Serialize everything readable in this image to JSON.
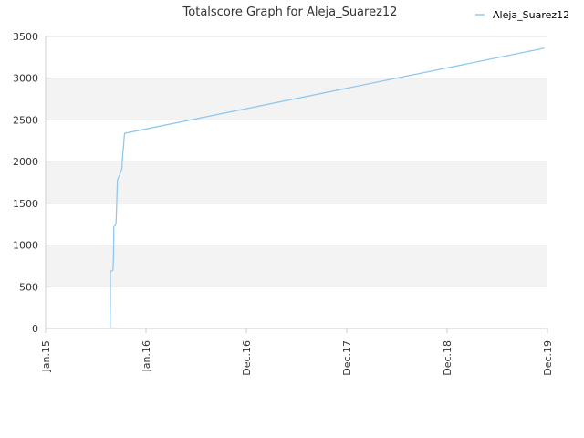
{
  "chart_data": {
    "type": "line",
    "title": "Totalscore Graph for Aleja_Suarez12",
    "xlabel": "",
    "ylabel": "",
    "x_ticks": [
      "Jan.15",
      "Jan.16",
      "Dec.16",
      "Dec.17",
      "Dec.18",
      "Dec.19"
    ],
    "y_ticks": [
      0,
      500,
      1000,
      1500,
      2000,
      2500,
      3000,
      3500
    ],
    "xlim": [
      "2015-01-01",
      "2019-12-01"
    ],
    "ylim": [
      0,
      3500
    ],
    "grid": "horizontal bands",
    "legend_position": "top-right",
    "colors": {
      "series": "#90c8ef",
      "band": "#f3f3f3",
      "grid": "#dddddd",
      "axis": "#cccccc"
    },
    "series": [
      {
        "name": "Aleja_Suarez12",
        "x": [
          "2015-08-20",
          "2015-08-21",
          "2015-08-30",
          "2015-09-01",
          "2015-09-02",
          "2015-09-08",
          "2015-09-10",
          "2015-09-15",
          "2015-09-25",
          "2015-10-01",
          "2015-10-02",
          "2015-10-03",
          "2015-10-04",
          "2015-10-05",
          "2015-10-06",
          "2015-10-07",
          "2015-10-08",
          "2015-10-09",
          "2015-10-10",
          "2015-10-11",
          "2019-11-20"
        ],
        "values": [
          0,
          680,
          700,
          860,
          1220,
          1240,
          1270,
          1780,
          1860,
          1920,
          2000,
          2050,
          2100,
          2130,
          2150,
          2200,
          2250,
          2290,
          2320,
          2340,
          3360
        ]
      }
    ]
  }
}
